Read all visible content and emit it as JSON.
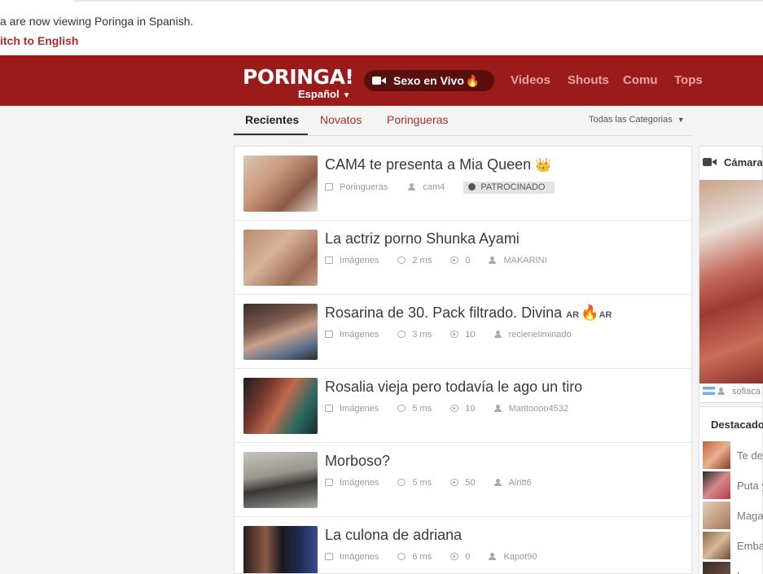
{
  "notice": {
    "text": "a are now viewing Poringa in Spanish.",
    "switch_link": "itch to English"
  },
  "header": {
    "logo": "PORINGA!",
    "language": "Español",
    "live_button": "Sexo en Vivo",
    "nav": [
      "Videos",
      "Shouts",
      "Comu",
      "Tops"
    ],
    "colors": {
      "brand": "#9b1b1b",
      "nav_text": "#e9a3a3"
    }
  },
  "tabs": {
    "items": [
      "Recientes",
      "Novatos",
      "Poringueras"
    ],
    "active": "Recientes",
    "category_select": "Todas las Categorias"
  },
  "posts": [
    {
      "title": "CAM4 te presenta a Mia Queen",
      "category": "Poringueras",
      "author": "cam4",
      "badge": "PATROCINADO"
    },
    {
      "title": "La actriz porno Shunka Ayami",
      "category": "Imágenes",
      "time": "2 ms",
      "points": "0",
      "author": "MAKARINI"
    },
    {
      "title": "Rosarina de 30. Pack filtrado. Divina",
      "title_suffix_a": "AR",
      "title_suffix_b": "AR",
      "category": "Imágenes",
      "time": "3 ms",
      "points": "10",
      "author": "recieneliminado"
    },
    {
      "title": "Rosalia vieja pero todavía le ago un tiro",
      "category": "Imágenes",
      "time": "5 ms",
      "points": "10",
      "author": "Maritoooo4532"
    },
    {
      "title": "Morboso?",
      "category": "Imágenes",
      "time": "5 ms",
      "points": "50",
      "author": "Airitt6"
    },
    {
      "title": "La culona de adriana",
      "category": "Imágenes",
      "time": "6 ms",
      "points": "0",
      "author": "Kapot90"
    }
  ],
  "sidebar": {
    "cam_title": "Cámara",
    "cam_user": "sofiaca",
    "featured_title": "Destacado",
    "featured_items": [
      "Te dej",
      "Puta y",
      "Maga",
      "Emba",
      "L"
    ]
  }
}
